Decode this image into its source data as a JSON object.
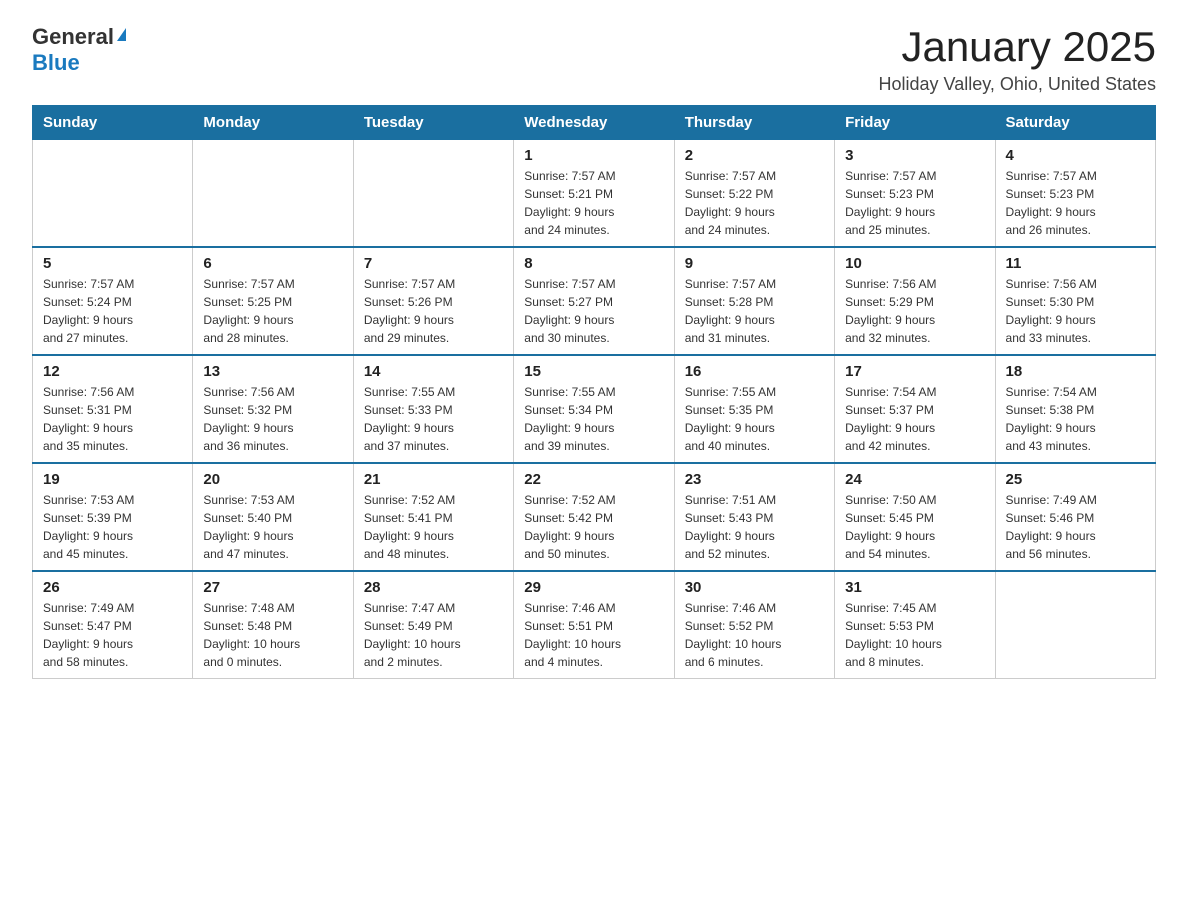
{
  "logo": {
    "general": "General",
    "blue": "Blue"
  },
  "header": {
    "month": "January 2025",
    "location": "Holiday Valley, Ohio, United States"
  },
  "weekdays": [
    "Sunday",
    "Monday",
    "Tuesday",
    "Wednesday",
    "Thursday",
    "Friday",
    "Saturday"
  ],
  "weeks": [
    [
      {
        "day": "",
        "info": ""
      },
      {
        "day": "",
        "info": ""
      },
      {
        "day": "",
        "info": ""
      },
      {
        "day": "1",
        "info": "Sunrise: 7:57 AM\nSunset: 5:21 PM\nDaylight: 9 hours\nand 24 minutes."
      },
      {
        "day": "2",
        "info": "Sunrise: 7:57 AM\nSunset: 5:22 PM\nDaylight: 9 hours\nand 24 minutes."
      },
      {
        "day": "3",
        "info": "Sunrise: 7:57 AM\nSunset: 5:23 PM\nDaylight: 9 hours\nand 25 minutes."
      },
      {
        "day": "4",
        "info": "Sunrise: 7:57 AM\nSunset: 5:23 PM\nDaylight: 9 hours\nand 26 minutes."
      }
    ],
    [
      {
        "day": "5",
        "info": "Sunrise: 7:57 AM\nSunset: 5:24 PM\nDaylight: 9 hours\nand 27 minutes."
      },
      {
        "day": "6",
        "info": "Sunrise: 7:57 AM\nSunset: 5:25 PM\nDaylight: 9 hours\nand 28 minutes."
      },
      {
        "day": "7",
        "info": "Sunrise: 7:57 AM\nSunset: 5:26 PM\nDaylight: 9 hours\nand 29 minutes."
      },
      {
        "day": "8",
        "info": "Sunrise: 7:57 AM\nSunset: 5:27 PM\nDaylight: 9 hours\nand 30 minutes."
      },
      {
        "day": "9",
        "info": "Sunrise: 7:57 AM\nSunset: 5:28 PM\nDaylight: 9 hours\nand 31 minutes."
      },
      {
        "day": "10",
        "info": "Sunrise: 7:56 AM\nSunset: 5:29 PM\nDaylight: 9 hours\nand 32 minutes."
      },
      {
        "day": "11",
        "info": "Sunrise: 7:56 AM\nSunset: 5:30 PM\nDaylight: 9 hours\nand 33 minutes."
      }
    ],
    [
      {
        "day": "12",
        "info": "Sunrise: 7:56 AM\nSunset: 5:31 PM\nDaylight: 9 hours\nand 35 minutes."
      },
      {
        "day": "13",
        "info": "Sunrise: 7:56 AM\nSunset: 5:32 PM\nDaylight: 9 hours\nand 36 minutes."
      },
      {
        "day": "14",
        "info": "Sunrise: 7:55 AM\nSunset: 5:33 PM\nDaylight: 9 hours\nand 37 minutes."
      },
      {
        "day": "15",
        "info": "Sunrise: 7:55 AM\nSunset: 5:34 PM\nDaylight: 9 hours\nand 39 minutes."
      },
      {
        "day": "16",
        "info": "Sunrise: 7:55 AM\nSunset: 5:35 PM\nDaylight: 9 hours\nand 40 minutes."
      },
      {
        "day": "17",
        "info": "Sunrise: 7:54 AM\nSunset: 5:37 PM\nDaylight: 9 hours\nand 42 minutes."
      },
      {
        "day": "18",
        "info": "Sunrise: 7:54 AM\nSunset: 5:38 PM\nDaylight: 9 hours\nand 43 minutes."
      }
    ],
    [
      {
        "day": "19",
        "info": "Sunrise: 7:53 AM\nSunset: 5:39 PM\nDaylight: 9 hours\nand 45 minutes."
      },
      {
        "day": "20",
        "info": "Sunrise: 7:53 AM\nSunset: 5:40 PM\nDaylight: 9 hours\nand 47 minutes."
      },
      {
        "day": "21",
        "info": "Sunrise: 7:52 AM\nSunset: 5:41 PM\nDaylight: 9 hours\nand 48 minutes."
      },
      {
        "day": "22",
        "info": "Sunrise: 7:52 AM\nSunset: 5:42 PM\nDaylight: 9 hours\nand 50 minutes."
      },
      {
        "day": "23",
        "info": "Sunrise: 7:51 AM\nSunset: 5:43 PM\nDaylight: 9 hours\nand 52 minutes."
      },
      {
        "day": "24",
        "info": "Sunrise: 7:50 AM\nSunset: 5:45 PM\nDaylight: 9 hours\nand 54 minutes."
      },
      {
        "day": "25",
        "info": "Sunrise: 7:49 AM\nSunset: 5:46 PM\nDaylight: 9 hours\nand 56 minutes."
      }
    ],
    [
      {
        "day": "26",
        "info": "Sunrise: 7:49 AM\nSunset: 5:47 PM\nDaylight: 9 hours\nand 58 minutes."
      },
      {
        "day": "27",
        "info": "Sunrise: 7:48 AM\nSunset: 5:48 PM\nDaylight: 10 hours\nand 0 minutes."
      },
      {
        "day": "28",
        "info": "Sunrise: 7:47 AM\nSunset: 5:49 PM\nDaylight: 10 hours\nand 2 minutes."
      },
      {
        "day": "29",
        "info": "Sunrise: 7:46 AM\nSunset: 5:51 PM\nDaylight: 10 hours\nand 4 minutes."
      },
      {
        "day": "30",
        "info": "Sunrise: 7:46 AM\nSunset: 5:52 PM\nDaylight: 10 hours\nand 6 minutes."
      },
      {
        "day": "31",
        "info": "Sunrise: 7:45 AM\nSunset: 5:53 PM\nDaylight: 10 hours\nand 8 minutes."
      },
      {
        "day": "",
        "info": ""
      }
    ]
  ]
}
